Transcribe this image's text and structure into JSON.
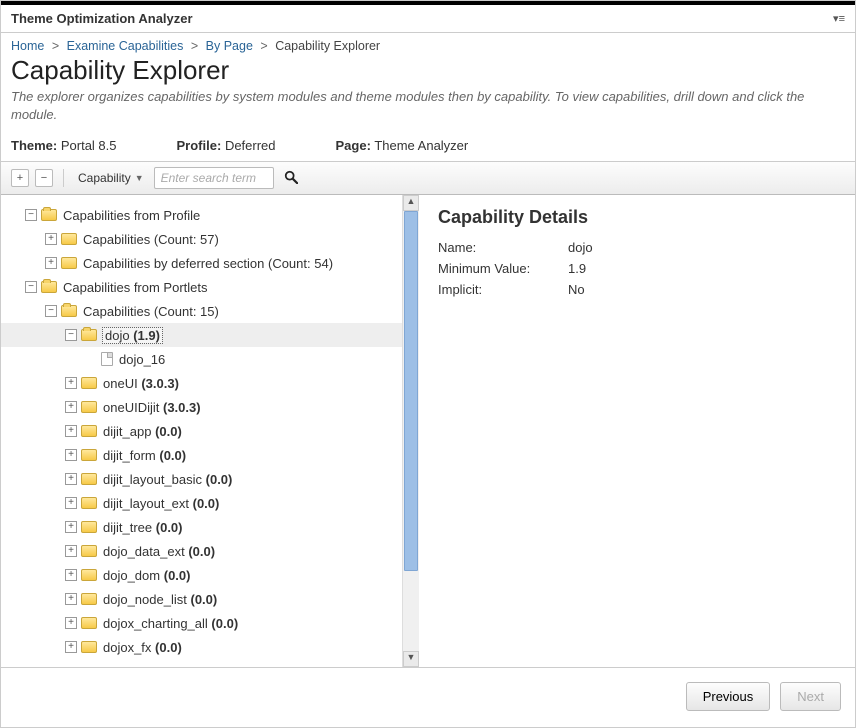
{
  "window": {
    "title": "Theme Optimization Analyzer"
  },
  "breadcrumbs": {
    "items": [
      {
        "label": "Home",
        "link": true
      },
      {
        "label": "Examine Capabilities",
        "link": true
      },
      {
        "label": "By Page",
        "link": true
      },
      {
        "label": "Capability Explorer",
        "link": false
      }
    ],
    "sep": ">"
  },
  "page": {
    "title": "Capability Explorer",
    "subtitle": "The explorer organizes capabilities by system modules and theme modules then by capability. To view capabilities, drill down and click the module."
  },
  "meta": {
    "theme_label": "Theme:",
    "theme_value": "Portal 8.5",
    "profile_label": "Profile:",
    "profile_value": "Deferred",
    "page_label": "Page:",
    "page_value": "Theme Analyzer"
  },
  "toolbar": {
    "expand_all": "+",
    "collapse_all": "−",
    "dropdown_label": "Capability",
    "search_placeholder": "Enter search term"
  },
  "tree": {
    "r0": {
      "label": "Capabilities from Profile"
    },
    "r1": {
      "label": "Capabilities (Count: 57)"
    },
    "r2": {
      "label": "Capabilities by deferred section (Count: 54)"
    },
    "r3": {
      "label": "Capabilities from Portlets"
    },
    "r4": {
      "label": "Capabilities (Count: 15)"
    },
    "r5": {
      "name": "dojo",
      "ver": "(1.9)"
    },
    "r6": {
      "label": "dojo_16"
    },
    "r7": {
      "name": "oneUI",
      "ver": "(3.0.3)"
    },
    "r8": {
      "name": "oneUIDijit",
      "ver": "(3.0.3)"
    },
    "r9": {
      "name": "dijit_app",
      "ver": "(0.0)"
    },
    "r10": {
      "name": "dijit_form",
      "ver": "(0.0)"
    },
    "r11": {
      "name": "dijit_layout_basic",
      "ver": "(0.0)"
    },
    "r12": {
      "name": "dijit_layout_ext",
      "ver": "(0.0)"
    },
    "r13": {
      "name": "dijit_tree",
      "ver": "(0.0)"
    },
    "r14": {
      "name": "dojo_data_ext",
      "ver": "(0.0)"
    },
    "r15": {
      "name": "dojo_dom",
      "ver": "(0.0)"
    },
    "r16": {
      "name": "dojo_node_list",
      "ver": "(0.0)"
    },
    "r17": {
      "name": "dojox_charting_all",
      "ver": "(0.0)"
    },
    "r18": {
      "name": "dojox_fx",
      "ver": "(0.0)"
    }
  },
  "details": {
    "heading": "Capability Details",
    "rows": {
      "name": {
        "k": "Name:",
        "v": "dojo"
      },
      "min": {
        "k": "Minimum Value:",
        "v": "1.9"
      },
      "imp": {
        "k": "Implicit:",
        "v": "No"
      }
    }
  },
  "footer": {
    "prev": "Previous",
    "next": "Next"
  }
}
